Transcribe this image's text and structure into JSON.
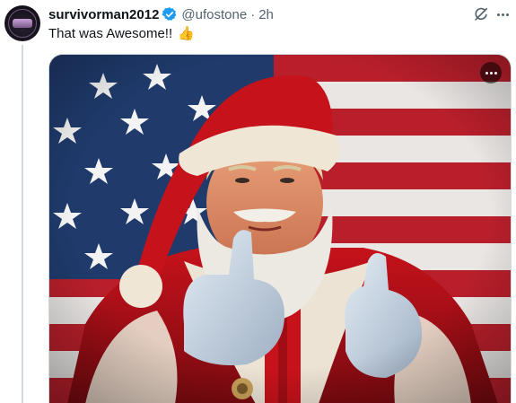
{
  "post": {
    "display_name": "survivorman2012",
    "handle": "@ufostone",
    "separator": "·",
    "time": "2h",
    "text": "That was Awesome!!",
    "emoji": "👍",
    "verified": true
  },
  "icons": {
    "verified": "verified-badge-icon",
    "grok": "grok-icon",
    "more": "more-options-icon",
    "media_more": "media-more-icon"
  },
  "colors": {
    "verified_blue": "#1d9bf0",
    "text_primary": "#0f1419",
    "text_secondary": "#536471",
    "thread_line": "#cfd9de"
  }
}
